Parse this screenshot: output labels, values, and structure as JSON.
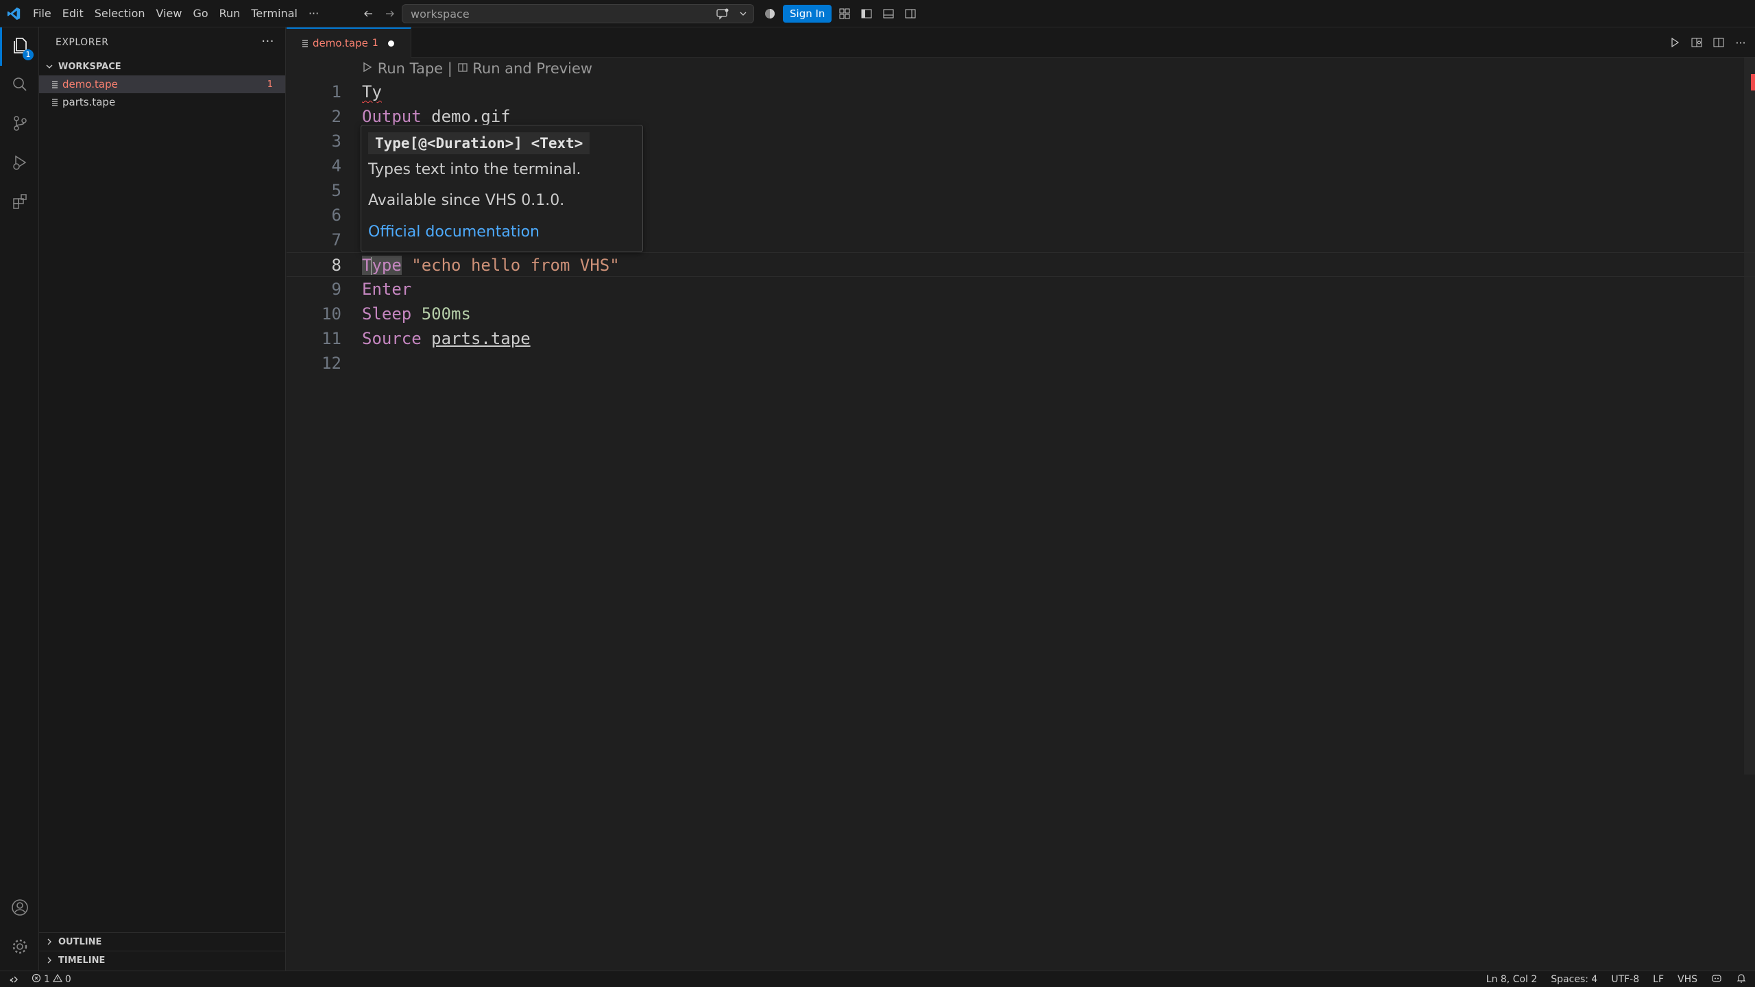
{
  "menu": [
    "File",
    "Edit",
    "Selection",
    "View",
    "Go",
    "Run",
    "Terminal",
    "···"
  ],
  "command_center": {
    "text": "workspace"
  },
  "sign_in": "Sign In",
  "activity": {
    "explorer_badge": "1"
  },
  "sidebar": {
    "title": "EXPLORER",
    "more": "···",
    "workspace_label": "WORKSPACE",
    "files": [
      {
        "name": "demo.tape",
        "badge": "1"
      },
      {
        "name": "parts.tape"
      }
    ],
    "outline_label": "OUTLINE",
    "timeline_label": "TIMELINE"
  },
  "tab": {
    "name": "demo.tape",
    "count": "1"
  },
  "codelens": {
    "run": "Run Tape",
    "sep": " | ",
    "preview": "Run and Preview"
  },
  "lines": [
    {
      "n": "1",
      "a": "Ty"
    },
    {
      "n": "2",
      "a": "Output",
      "b": " demo.gif"
    },
    {
      "n": "3"
    },
    {
      "n": "4"
    },
    {
      "n": "5"
    },
    {
      "n": "6"
    },
    {
      "n": "7"
    },
    {
      "n": "8",
      "a": "T",
      "b": "ype",
      "c": " \"echo hello from VHS\""
    },
    {
      "n": "9",
      "a": "Enter"
    },
    {
      "n": "10",
      "a": "Sleep",
      "b": " 500ms"
    },
    {
      "n": "11",
      "a": "Source",
      "b": "parts.tape"
    },
    {
      "n": "12"
    }
  ],
  "hover": {
    "signature": "Type[@<Duration>] <Text>",
    "description": "Types text into the terminal.",
    "since": "Available since VHS 0.1.0.",
    "link": "Official documentation"
  },
  "status": {
    "errors": "1",
    "warnings": "0",
    "position": "Ln 8, Col 2",
    "spaces": "Spaces: 4",
    "encoding": "UTF-8",
    "eol": "LF",
    "language": "VHS"
  },
  "colors": {
    "accent": "#0078d4",
    "error": "#f88070",
    "keyword": "#c586c0",
    "string": "#ce9178",
    "number": "#b5cea8",
    "link": "#4daafc"
  }
}
